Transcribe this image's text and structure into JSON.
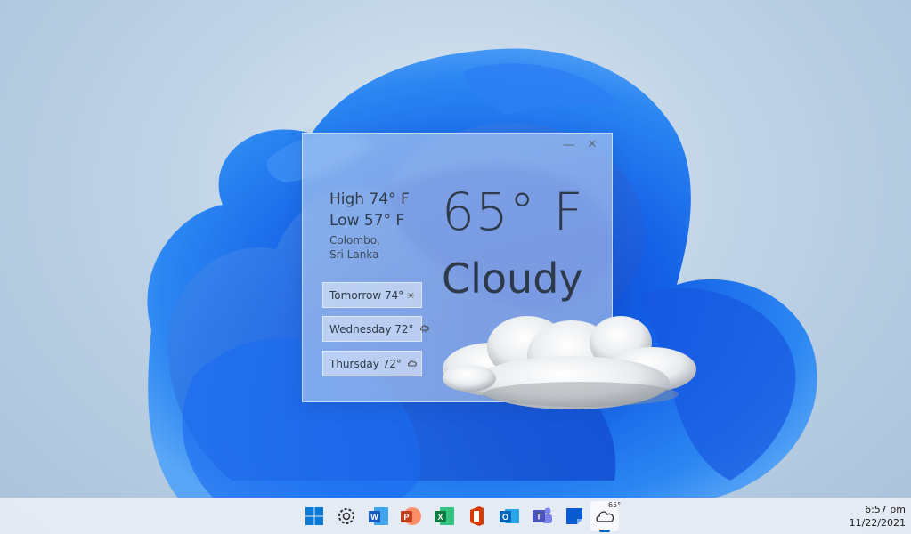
{
  "widget": {
    "high": "High 74° F",
    "low": "Low 57° F",
    "location_line1": "Colombo,",
    "location_line2": "Sri Lanka",
    "temperature": "65° F",
    "condition": "Cloudy",
    "minimize_icon": "minimize-icon",
    "close_icon": "close-icon",
    "forecast": [
      {
        "label": "Tomorrow 74°",
        "icon": "sun-icon"
      },
      {
        "label": "Wednesday 72°",
        "icon": "cloud-rain-icon"
      },
      {
        "label": "Thursday 72°",
        "icon": "cloud-icon"
      }
    ]
  },
  "taskbar": {
    "apps": [
      "start",
      "settings",
      "word",
      "powerpoint",
      "excel",
      "office",
      "outlook",
      "teams",
      "notes",
      "weather"
    ],
    "weather_badge": "65°",
    "time": "6:57 pm",
    "date": "11/22/2021"
  },
  "colors": {
    "accent": "#0067c0",
    "wallpaper_bloom": "#1565e8"
  }
}
